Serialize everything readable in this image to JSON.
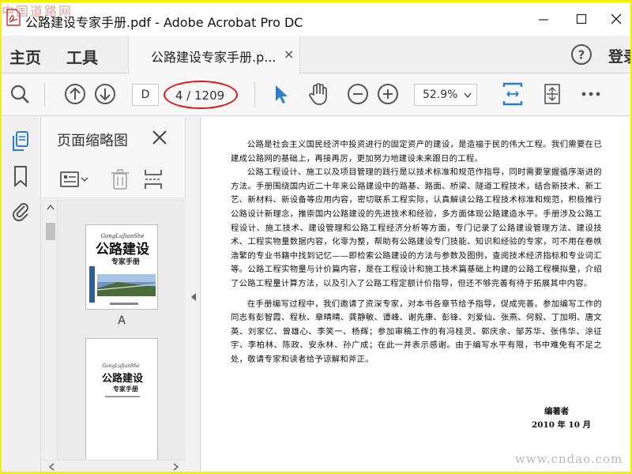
{
  "window": {
    "title": "公路建设专家手册.pdf - Adobe Acrobat Pro DC",
    "watermark_top": "中国道路网"
  },
  "tabs": {
    "home": "主页",
    "tools": "工具",
    "document": "公路建设专家手册.p...",
    "document_close": "×",
    "signin": "登录"
  },
  "toolbar": {
    "page_input": "D",
    "page_count": "4 / 1209",
    "zoom": "52.9%"
  },
  "panel": {
    "title": "页面缩略图",
    "thumbnails": [
      {
        "label": "A",
        "cover_pinyin": "GongLuJianShe",
        "cover_title": "公路建设",
        "cover_subtitle": "专家手册"
      },
      {
        "label": "",
        "cover_pinyin": "GongLuJianShe",
        "cover_title": "公路建设",
        "cover_subtitle": "专家手册"
      }
    ]
  },
  "document": {
    "paragraphs": [
      "公路是社会主义国民经济中投资进行的固定资产的建设，是造福于民的伟大工程。我们需要在已建成公路网的基础上，再接再厉，更加努力地建设未来跟日的工程。",
      "公路工程设计、施工以及项目管理的践行是以技术标准和规范作指导，同时需要掌握循序渐进的方法。手册围绕国内近二十年来公路建设中的路基、路面、桥梁、隧道工程技术，结合新技术、新工艺、新材料、新设备等应用内容，密切联系工程实际，认真解读公路工程技术标准和规范，积极推行公路设计新理念，推崇国内公路建设的先进技术和经验，多方面体现公路建造水平。手册涉及公路工程设计、施工技术、建设管理和公路工程经济分析等方面，专门记录了公路建设管理方法、建设技术、工程实物量数据内容，化零为整，帮助有公路建设专门技能、知识和经验的专家，可不用在卷帙浩繁的专业书籍中找到记忆——即检索公路建设的方法与参数及图例，查阅技术经济指标和专业词汇等。公路工程实物量与计价篇内容，是在工程设计和施工技术篇基础上构建的公路工程模拟量，介绍了公路工程量计算方法，以及引入了公路工程定额计价指导，但还不够完善有待于拓展其中内容。",
      "在手册编写过程中，我们邀请了资深专家，对本书各章节给予指导，促成完善。参加编写工作的同志有彭智霞、程秋、章晴晴、龚静敏、谭峰、谢先康、彭锋、刘爱仙、张燕、何毅、丁加明、唐文英、刘家亿、曾雄心、李笑一、杨辉；参加审稿工作的有冯桂灵、郭庆余、邹苏华、张伟华、涂征宇、李柏林、陈政、安永林、孙广成；在此一并表示感谢。由于编写水平有限，书中难免有不足之处，敬请专家和读者给予谅解和斧正。"
    ],
    "signature": "编著者",
    "date": "2010 年 10 月",
    "watermark_bottom": "www.cndao.com"
  },
  "colors": {
    "accent_blue": "#2a7fd4",
    "highlight_red": "#e01515",
    "border_yellow": "#f2f200"
  }
}
